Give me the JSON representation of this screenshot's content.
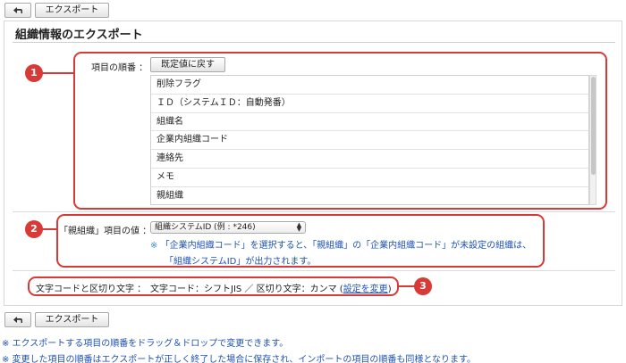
{
  "toolbar": {
    "back_icon": "back-arrow-icon",
    "export_label": "エクスポート"
  },
  "page": {
    "title": "組織情報のエクスポート"
  },
  "order_section": {
    "label": "項目の順番 ：",
    "reset_label": "既定値に戻す",
    "items": [
      "削除フラグ",
      "ＩＤ（システムＩＤ：自動発番）",
      "組織名",
      "企業内組織コード",
      "連絡先",
      "メモ",
      "親組織"
    ]
  },
  "parent_section": {
    "label": "「親組織」項目の値 ：",
    "selected": "組織システムID (例 : *246)",
    "note_mark": "※",
    "note_line1": "「企業内組織コード」を選択すると、「親組織」の「企業内組織コード」が未設定の組織は、",
    "note_line2": "「組織システムID」が出力されます。"
  },
  "encoding_section": {
    "label": "文字コードと区切り文字 ：",
    "value": "文字コード：シフトJIS ／ 区切り文字：カンマ (",
    "change_link": "設定を変更",
    "value_end": ")"
  },
  "badges": [
    "1",
    "2",
    "3"
  ],
  "footer": {
    "note1": "※ エクスポートする項目の順番をドラッグ＆ドロップで変更できます。",
    "note2": "※ 変更した項目の順番はエクスポートが正しく終了した場合に保存され、インポートの項目の順番も同様となります。"
  },
  "colors": {
    "highlight": "#d73a37",
    "note_text": "#1f52b5"
  }
}
